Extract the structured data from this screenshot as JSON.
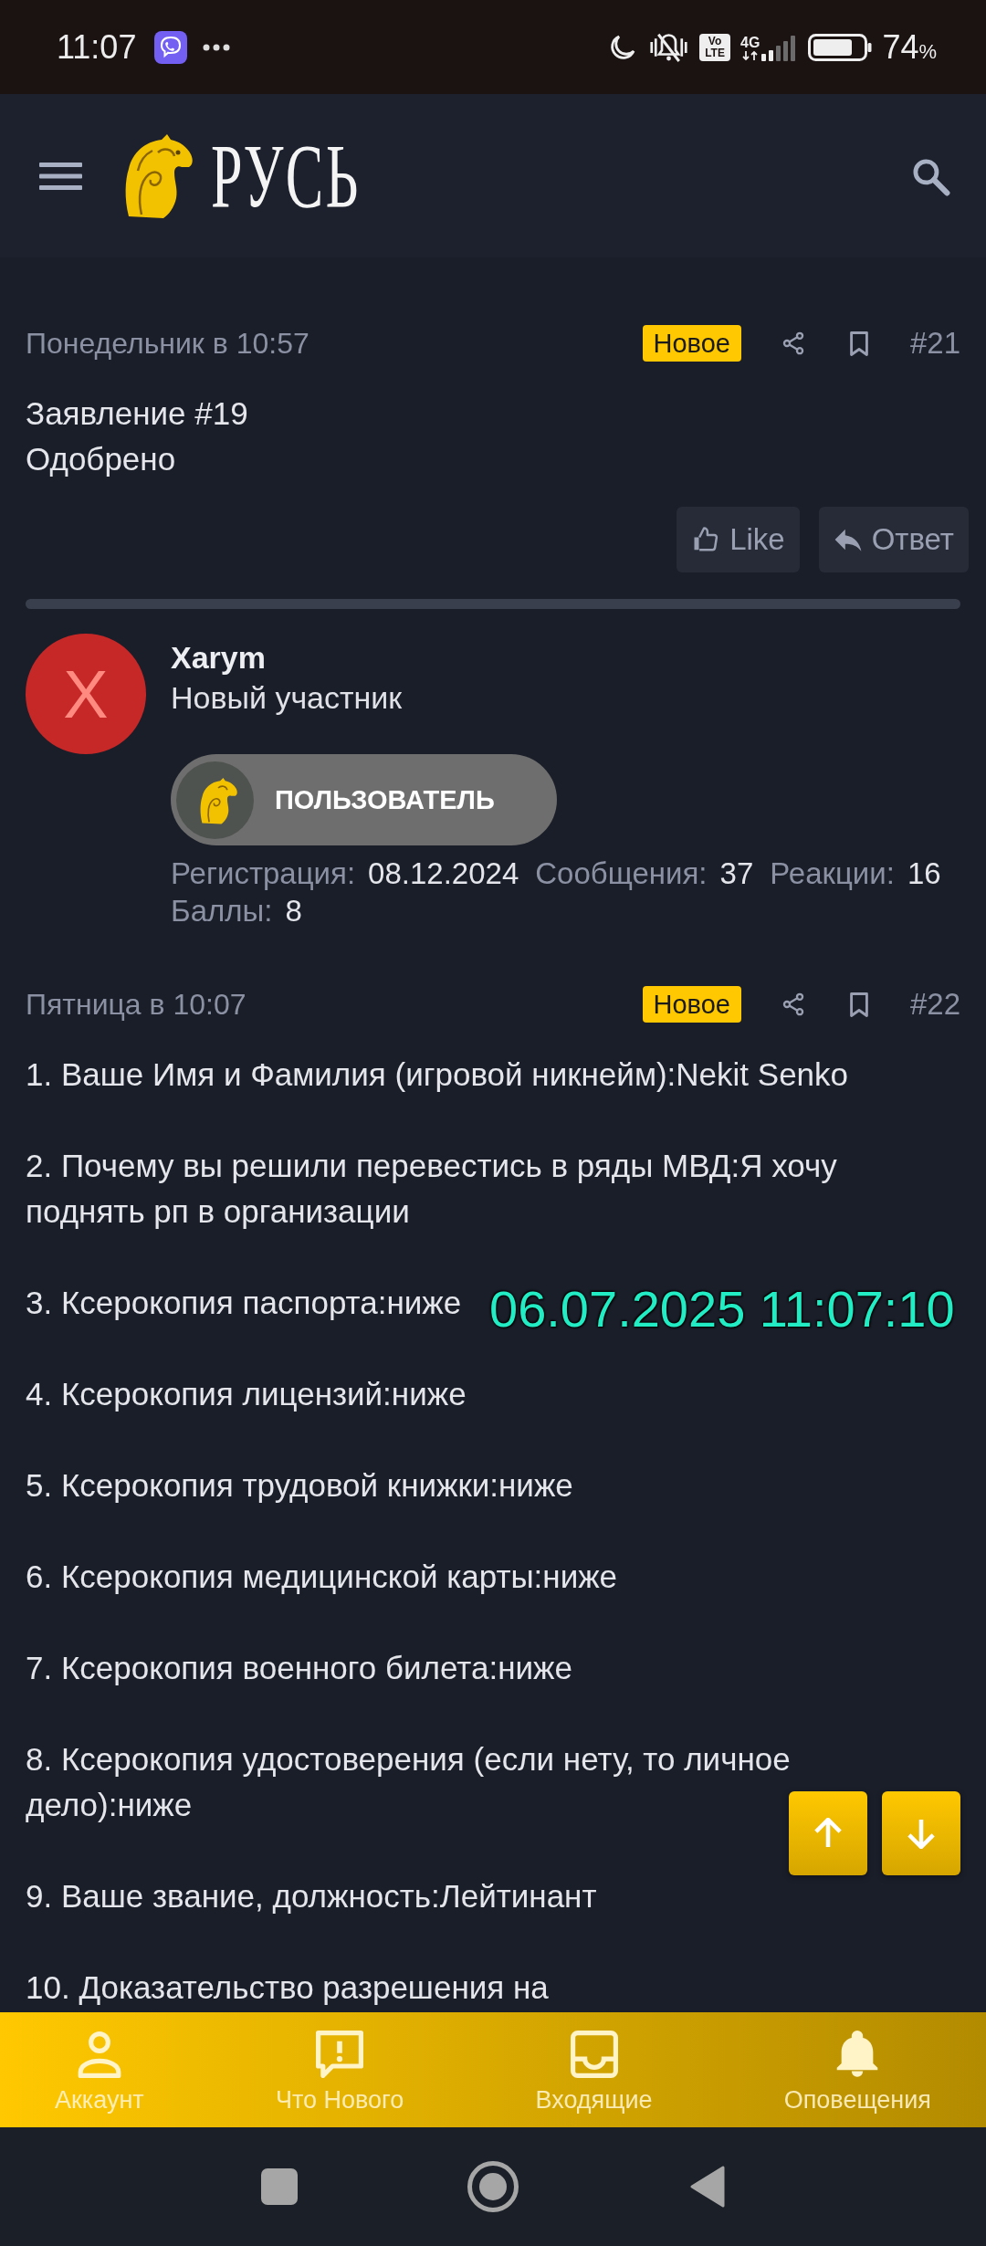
{
  "status_bar": {
    "time": "11:07",
    "volte": [
      "Vo",
      "LTE"
    ],
    "network_type": "4G",
    "battery_percent": "74",
    "battery_unit": "%"
  },
  "header": {
    "logo_text": "РУСЬ"
  },
  "posts": [
    {
      "date": "Понедельник в 10:57",
      "badge": "Новое",
      "number": "#21",
      "paragraphs": [
        [
          "Заявление #19",
          "Одобрено"
        ]
      ],
      "actions": [
        {
          "kind": "like",
          "label": "Like"
        },
        {
          "kind": "reply",
          "label": "Ответ"
        }
      ]
    },
    {
      "author": {
        "avatar_letter": "X",
        "name": "Xarym",
        "title": "Новый участник",
        "banner": "ПОЛЬЗОВАТЕЛЬ",
        "stats": [
          {
            "label": "Регистрация:",
            "value": "08.12.2024"
          },
          {
            "label": "Сообщения:",
            "value": "37"
          },
          {
            "label": "Реакции:",
            "value": "16"
          },
          {
            "label": "Баллы:",
            "value": "8"
          }
        ]
      },
      "date": "Пятница в 10:07",
      "badge": "Новое",
      "number": "#22",
      "paragraphs": [
        [
          "1. Ваше Имя и Фамилия (игровой никнейм):Nekit Senko"
        ],
        [
          "2. Почему вы решили перевестись в ряды МВД:Я хочу поднять рп в организации"
        ],
        [
          "3. Ксерокопия паспорта:ниже"
        ],
        [
          "4. Ксерокопия лицензий:ниже"
        ],
        [
          "5. Ксерокопия трудовой книжки:ниже"
        ],
        [
          "6. Ксерокопия медицинской карты:ниже"
        ],
        [
          "7. Ксерокопия военного билета:ниже"
        ],
        [
          "8. Ксерокопия удостоверения (если нету, то личное дело):ниже"
        ],
        [
          "9. Ваше звание, должность:Лейтинант"
        ],
        [
          "10. Доказательство разрешения на"
        ]
      ]
    }
  ],
  "overlay": {
    "timestamp": "06.07.2025 11:07:10"
  },
  "scroll_buttons": [
    {
      "kind": "up"
    },
    {
      "kind": "down"
    }
  ],
  "bottom_nav": [
    {
      "kind": "account",
      "label": "Аккаунт"
    },
    {
      "kind": "whats_new",
      "label": "Что Нового"
    },
    {
      "kind": "inbox",
      "label": "Входящие"
    },
    {
      "kind": "alerts",
      "label": "Оповещения"
    }
  ]
}
